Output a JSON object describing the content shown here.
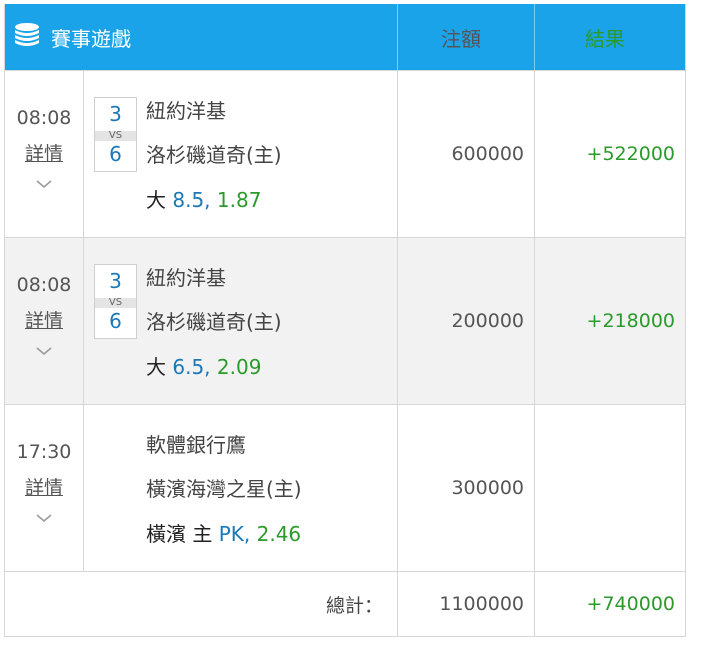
{
  "header": {
    "icon": "coin-stack-icon",
    "title": "賽事遊戲",
    "amount_label": "注額",
    "result_label": "結果"
  },
  "rows": [
    {
      "time": "08:08",
      "detail": "詳情",
      "score_home": "3",
      "vs": "VS",
      "score_away": "6",
      "team1": "紐約洋基",
      "team2": "洛杉磯道奇(主)",
      "bet_pick": "大 ",
      "bet_line": "8.5,",
      "bet_odds": " 1.87",
      "amount": "600000",
      "result": "+522000"
    },
    {
      "time": "08:08",
      "detail": "詳情",
      "score_home": "3",
      "vs": "VS",
      "score_away": "6",
      "team1": "紐約洋基",
      "team2": "洛杉磯道奇(主)",
      "bet_pick": "大 ",
      "bet_line": "6.5,",
      "bet_odds": " 2.09",
      "amount": "200000",
      "result": "+218000"
    },
    {
      "time": "17:30",
      "detail": "詳情",
      "team1": "軟體銀行鷹",
      "team2": "橫濱海灣之星(主)",
      "bet_pick": "橫濱 主 ",
      "bet_line": "PK,",
      "bet_odds": " 2.46",
      "amount": "300000",
      "result": ""
    }
  ],
  "footer": {
    "total_label": "總計：",
    "total_amount": "1100000",
    "total_result": "+740000"
  },
  "colors": {
    "header_bg": "#1aa3e8",
    "win_green": "#2a9a2a",
    "line_blue": "#1a78b8"
  }
}
